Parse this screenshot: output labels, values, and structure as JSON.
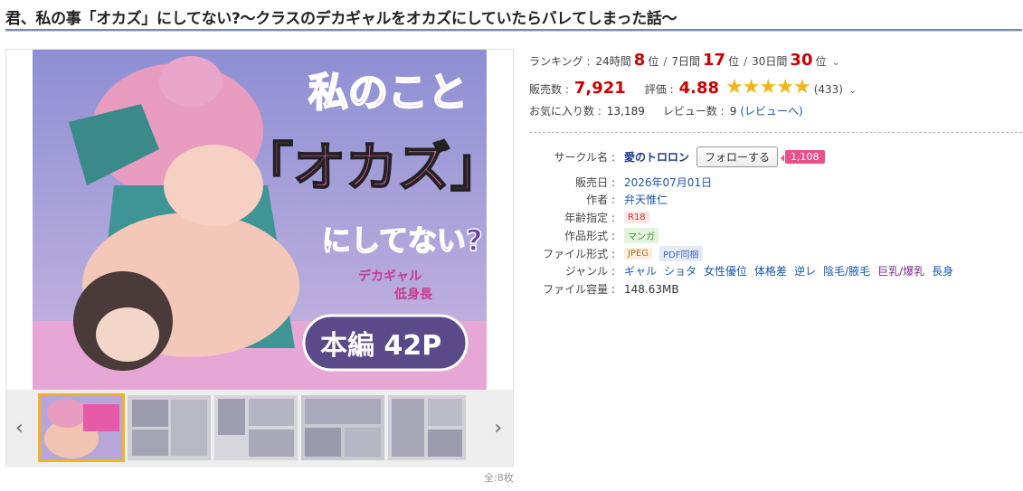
{
  "title": "君、私の事「オカズ」にしてない?〜クラスのデカギャルをオカズにしていたらバレてしまった話〜",
  "cover": {
    "title_line1": "私のこと",
    "title_line2": "「オカズ」",
    "title_line3": "にしてない?",
    "tag_a": "デカギャル",
    "tag_b": "低身長",
    "pages": "本編 42P"
  },
  "gallery": {
    "count_label": "全:8枚",
    "prev_icon": "‹",
    "next_icon": "›"
  },
  "ranking": {
    "label": "ランキング :",
    "p24_label": "24時間",
    "p24_value": "8",
    "p24_unit": "位",
    "d7_label": "7日間",
    "d7_value": "17",
    "d7_unit": "位",
    "d30_label": "30日間",
    "d30_value": "30",
    "d30_unit": "位"
  },
  "sales": {
    "label": "販売数 :",
    "value": "7,921",
    "rating_label": "評価 :",
    "rating": "4.88",
    "stars": 5,
    "rating_count": "(433)"
  },
  "favorites": {
    "label": "お気に入り数 :",
    "value": "13,189",
    "review_label": "レビュー数 :",
    "review_value": "9",
    "review_link": "(レビューへ)"
  },
  "specs": {
    "circle_label": "サークル名 :",
    "circle_name": "愛のトロロン",
    "follow_label": "フォローする",
    "follow_count": "1,108",
    "date_label": "販売日 :",
    "date_value": "2026年07月01日",
    "author_label": "作者 :",
    "author_value": "弁天惟仁",
    "age_label": "年齢指定 :",
    "age_value": "R18",
    "format_label": "作品形式 :",
    "format_value": "マンガ",
    "file_label": "ファイル形式 :",
    "file_jpeg": "JPEG",
    "file_pdf": "PDF同梱",
    "genre_label": "ジャンル :",
    "genres": [
      "ギャル",
      "ショタ",
      "女性優位",
      "体格差",
      "逆レ",
      "陰毛/腋毛",
      "巨乳/爆乳",
      "長身"
    ],
    "size_label": "ファイル容量 :",
    "size_value": "148.63MB"
  },
  "colors": {
    "accent_red": "#cc0000",
    "star": "#f3b31c",
    "link": "#1a56b0",
    "follow_badge": "#e8508a"
  }
}
